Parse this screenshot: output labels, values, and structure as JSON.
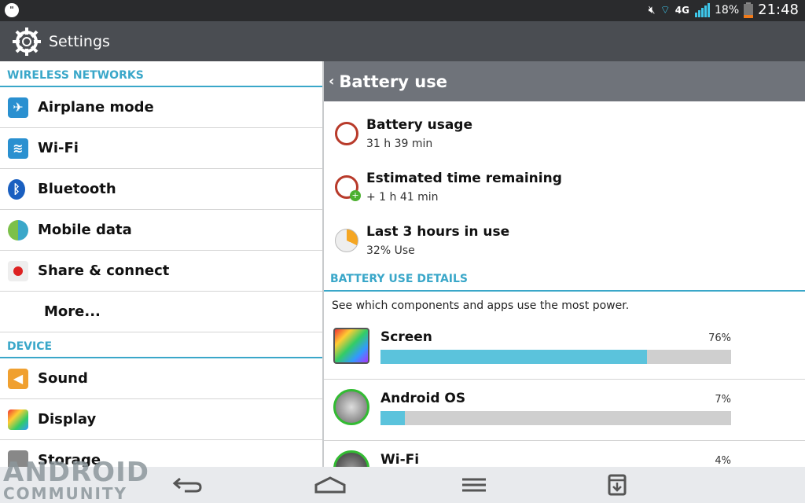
{
  "status_bar": {
    "battery_percent": "18%",
    "time": "21:48",
    "network": "4G",
    "icons": [
      "hangouts-icon",
      "mute-icon",
      "wifi-icon",
      "4g-icon",
      "signal-icon",
      "battery-icon"
    ]
  },
  "action_bar": {
    "title": "Settings",
    "icon": "gear-icon"
  },
  "left_pane": {
    "sections": [
      {
        "header": "WIRELESS NETWORKS",
        "items": [
          {
            "label": "Airplane mode",
            "icon": "airplane-icon"
          },
          {
            "label": "Wi-Fi",
            "icon": "wifi-icon"
          },
          {
            "label": "Bluetooth",
            "icon": "bluetooth-icon"
          },
          {
            "label": "Mobile data",
            "icon": "mobile-data-icon"
          },
          {
            "label": "Share & connect",
            "icon": "share-icon"
          },
          {
            "label": "More...",
            "icon": ""
          }
        ]
      },
      {
        "header": "DEVICE",
        "items": [
          {
            "label": "Sound",
            "icon": "sound-icon"
          },
          {
            "label": "Display",
            "icon": "display-icon"
          },
          {
            "label": "Storage",
            "icon": "storage-icon"
          }
        ]
      }
    ]
  },
  "right_pane": {
    "title": "Battery use",
    "rows": [
      {
        "title": "Battery usage",
        "subtitle": "31 h 39 min",
        "icon": "clock-icon"
      },
      {
        "title": "Estimated time remaining",
        "subtitle": "+ 1 h 41 min",
        "icon": "clock-plus-icon"
      },
      {
        "title": "Last 3 hours in use",
        "subtitle": "32% Use",
        "icon": "pie-icon"
      }
    ],
    "details_header": "BATTERY USE DETAILS",
    "details_desc": "See which components and apps use the most power.",
    "apps": [
      {
        "name": "Screen",
        "percent": "76%",
        "value": 76
      },
      {
        "name": "Android OS",
        "percent": "7%",
        "value": 7
      },
      {
        "name": "Wi-Fi",
        "percent": "4%",
        "value": 4
      }
    ]
  },
  "nav_bar": {
    "buttons": [
      "back",
      "home",
      "menu",
      "notes"
    ]
  },
  "watermark": {
    "line1": "ANDROID",
    "line2": "COMMUNITY"
  },
  "colors": {
    "accent": "#3aa7c9",
    "bar_fill": "#5bc3dc",
    "bar_track": "#cfcfcf"
  }
}
